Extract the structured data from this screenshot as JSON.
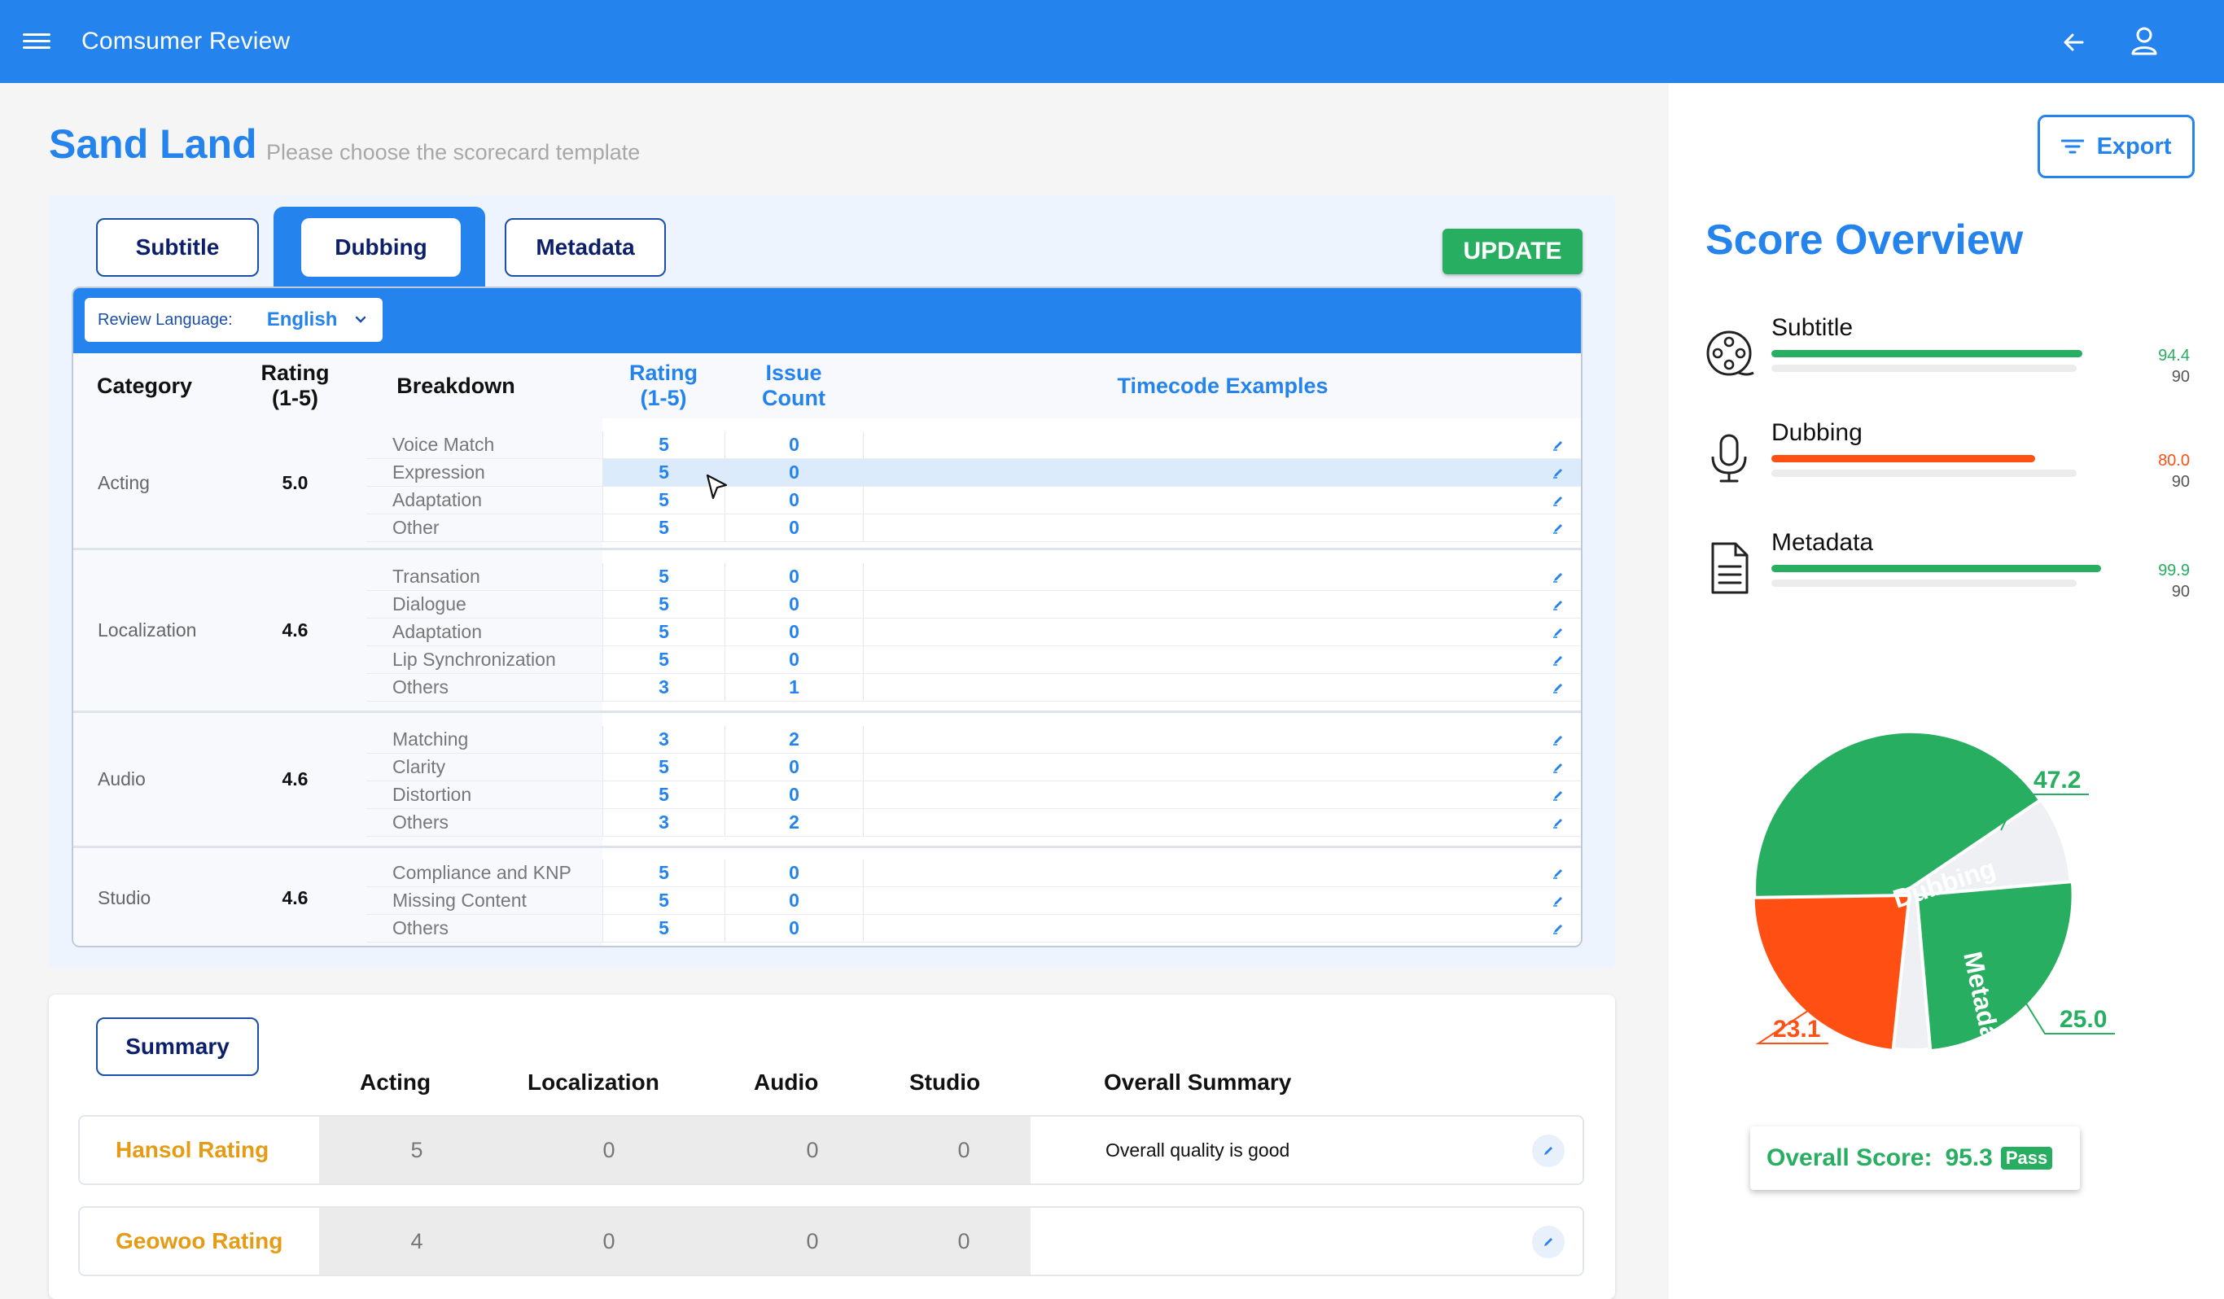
{
  "app": {
    "title": "Comsumer Review"
  },
  "page": {
    "title": "Sand Land",
    "subtitle": "Please choose the scorecard template"
  },
  "tabs": [
    {
      "label": "Subtitle",
      "active": false
    },
    {
      "label": "Dubbing",
      "active": true
    },
    {
      "label": "Metadata",
      "active": false
    }
  ],
  "update_label": "UPDATE",
  "export_label": "Export",
  "language": {
    "label": "Review Language:",
    "value": "English"
  },
  "table": {
    "headers": {
      "category": "Category",
      "rating": "Rating\n(1-5)",
      "breakdown": "Breakdown",
      "sub_rating": "Rating\n(1-5)",
      "issue_count": "Issue\nCount",
      "timecode": "Timecode Examples"
    },
    "groups": [
      {
        "category": "Acting",
        "rating": "5.0",
        "rows": [
          {
            "name": "Voice Match",
            "rating": "5",
            "issues": "0"
          },
          {
            "name": "Expression",
            "rating": "5",
            "issues": "0",
            "highlight": true
          },
          {
            "name": "Adaptation",
            "rating": "5",
            "issues": "0"
          },
          {
            "name": "Other",
            "rating": "5",
            "issues": "0"
          }
        ]
      },
      {
        "category": "Localization",
        "rating": "4.6",
        "rows": [
          {
            "name": "Transation",
            "rating": "5",
            "issues": "0"
          },
          {
            "name": "Dialogue",
            "rating": "5",
            "issues": "0"
          },
          {
            "name": "Adaptation",
            "rating": "5",
            "issues": "0"
          },
          {
            "name": "Lip Synchronization",
            "rating": "5",
            "issues": "0"
          },
          {
            "name": "Others",
            "rating": "3",
            "issues": "1"
          }
        ]
      },
      {
        "category": "Audio",
        "rating": "4.6",
        "rows": [
          {
            "name": "Matching",
            "rating": "3",
            "issues": "2"
          },
          {
            "name": "Clarity",
            "rating": "5",
            "issues": "0"
          },
          {
            "name": "Distortion",
            "rating": "5",
            "issues": "0"
          },
          {
            "name": "Others",
            "rating": "3",
            "issues": "2"
          }
        ]
      },
      {
        "category": "Studio",
        "rating": "4.6",
        "rows": [
          {
            "name": "Compliance and KNP",
            "rating": "5",
            "issues": "0"
          },
          {
            "name": "Missing Content",
            "rating": "5",
            "issues": "0"
          },
          {
            "name": "Others",
            "rating": "5",
            "issues": "0"
          }
        ]
      }
    ]
  },
  "summary": {
    "tab_label": "Summary",
    "headers": [
      "Acting",
      "Localization",
      "Audio",
      "Studio",
      "Overall Summary"
    ],
    "rows": [
      {
        "name": "Hansol Rating",
        "values": [
          "5",
          "0",
          "0",
          "0"
        ],
        "overall": "Overall quality  is good"
      },
      {
        "name": "Geowoo Rating",
        "values": [
          "4",
          "0",
          "0",
          "0"
        ],
        "overall": ""
      }
    ]
  },
  "score_overview": {
    "title": "Score Overview",
    "items": [
      {
        "label": "Subtitle",
        "score": "94.4",
        "threshold": "90",
        "color": "#27ae60",
        "icon": "film-reel-icon"
      },
      {
        "label": "Dubbing",
        "score": "80.0",
        "threshold": "90",
        "color": "#ff4f12",
        "icon": "microphone-icon"
      },
      {
        "label": "Metadata",
        "score": "99.9",
        "threshold": "90",
        "color": "#27ae60",
        "icon": "document-icon"
      }
    ],
    "overall_label": "Overall Score:",
    "overall_value": "95.3",
    "pass_label": "Pass"
  },
  "chart_data": {
    "type": "pie",
    "slices": [
      {
        "label": "Subtitle",
        "value": 47.2,
        "value_label": "47.2",
        "color": "#27ae60"
      },
      {
        "label": "Metadata",
        "value": 25.0,
        "value_label": "25.0",
        "color": "#27ae60"
      },
      {
        "label": "Dubbing",
        "value": 23.1,
        "value_label": "23.1",
        "color": "#ff4f12"
      }
    ],
    "remainder_color": "#eef0f4"
  }
}
